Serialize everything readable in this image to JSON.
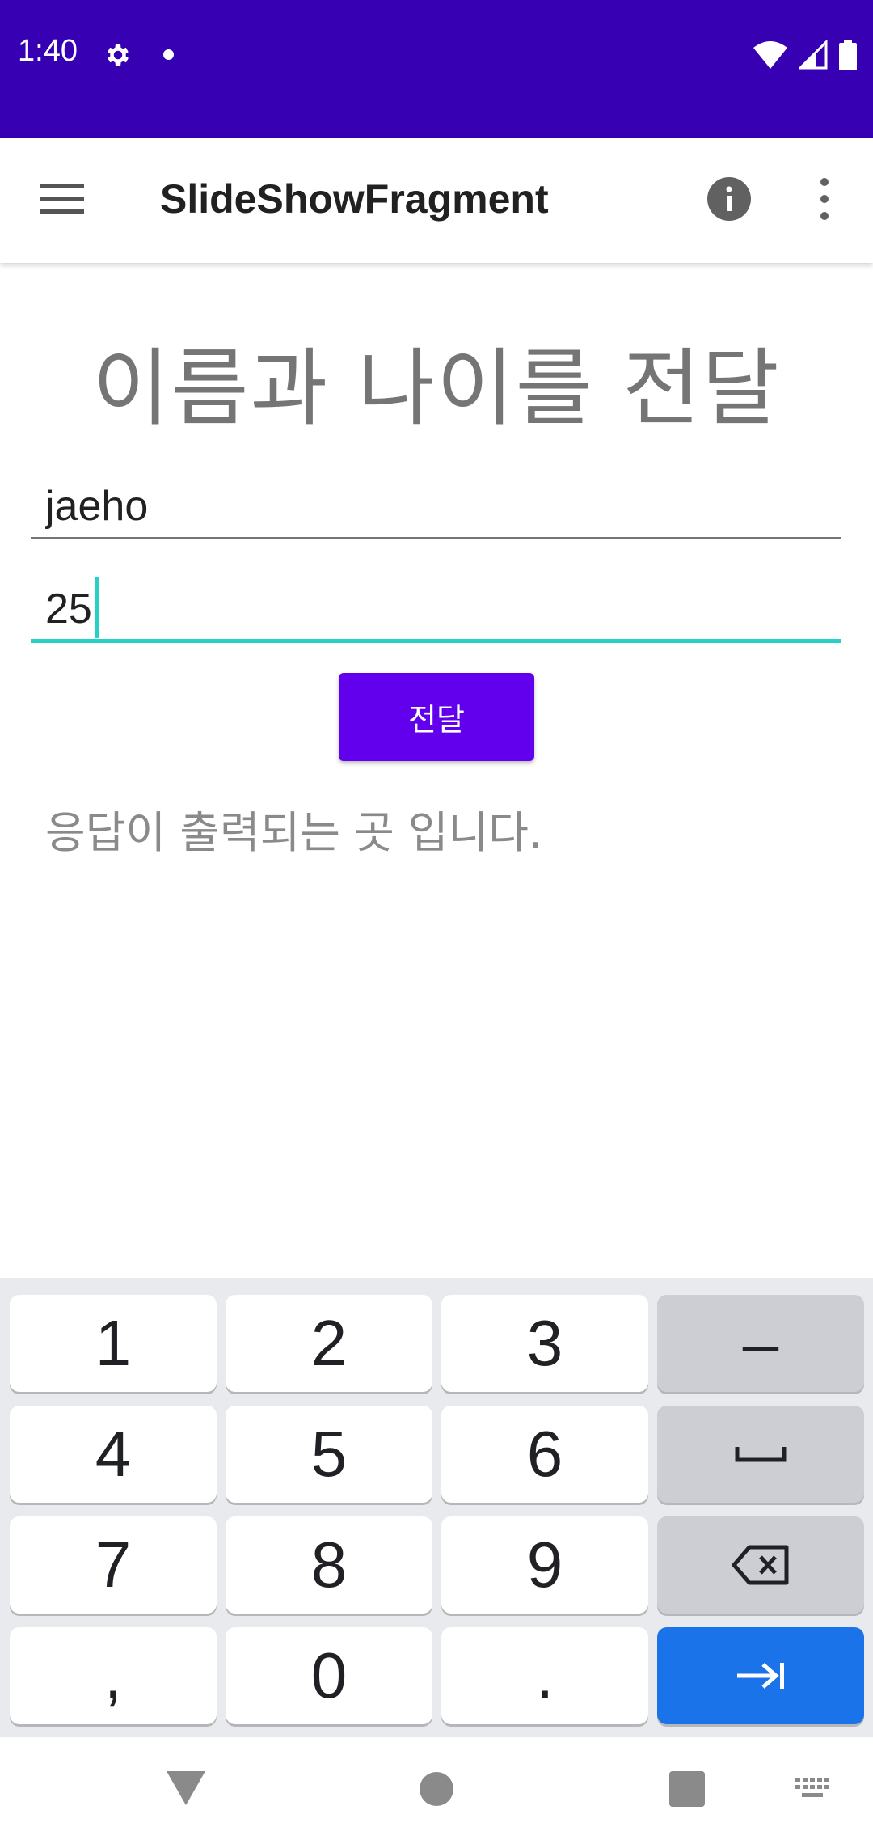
{
  "status_bar": {
    "time": "1:40",
    "bg_color": "#3700b3"
  },
  "app_bar": {
    "title": "SlideShowFragment"
  },
  "main": {
    "heading": "이름과 나이를 전달",
    "name_field": {
      "value": "jaeho"
    },
    "age_field": {
      "value": "25"
    },
    "send_button": "전달",
    "response_text": "응답이 출력되는 곳 입니다."
  },
  "keyboard": {
    "keys": [
      "1",
      "2",
      "3",
      "–",
      "4",
      "5",
      "6",
      "␣",
      "7",
      "8",
      "9",
      "⌫",
      ",",
      "0",
      ".",
      "⇥"
    ],
    "action_color": "#1a73e8"
  },
  "colors": {
    "accent": "#26d0c4",
    "primary": "#6200ee",
    "status": "#3700b3"
  }
}
